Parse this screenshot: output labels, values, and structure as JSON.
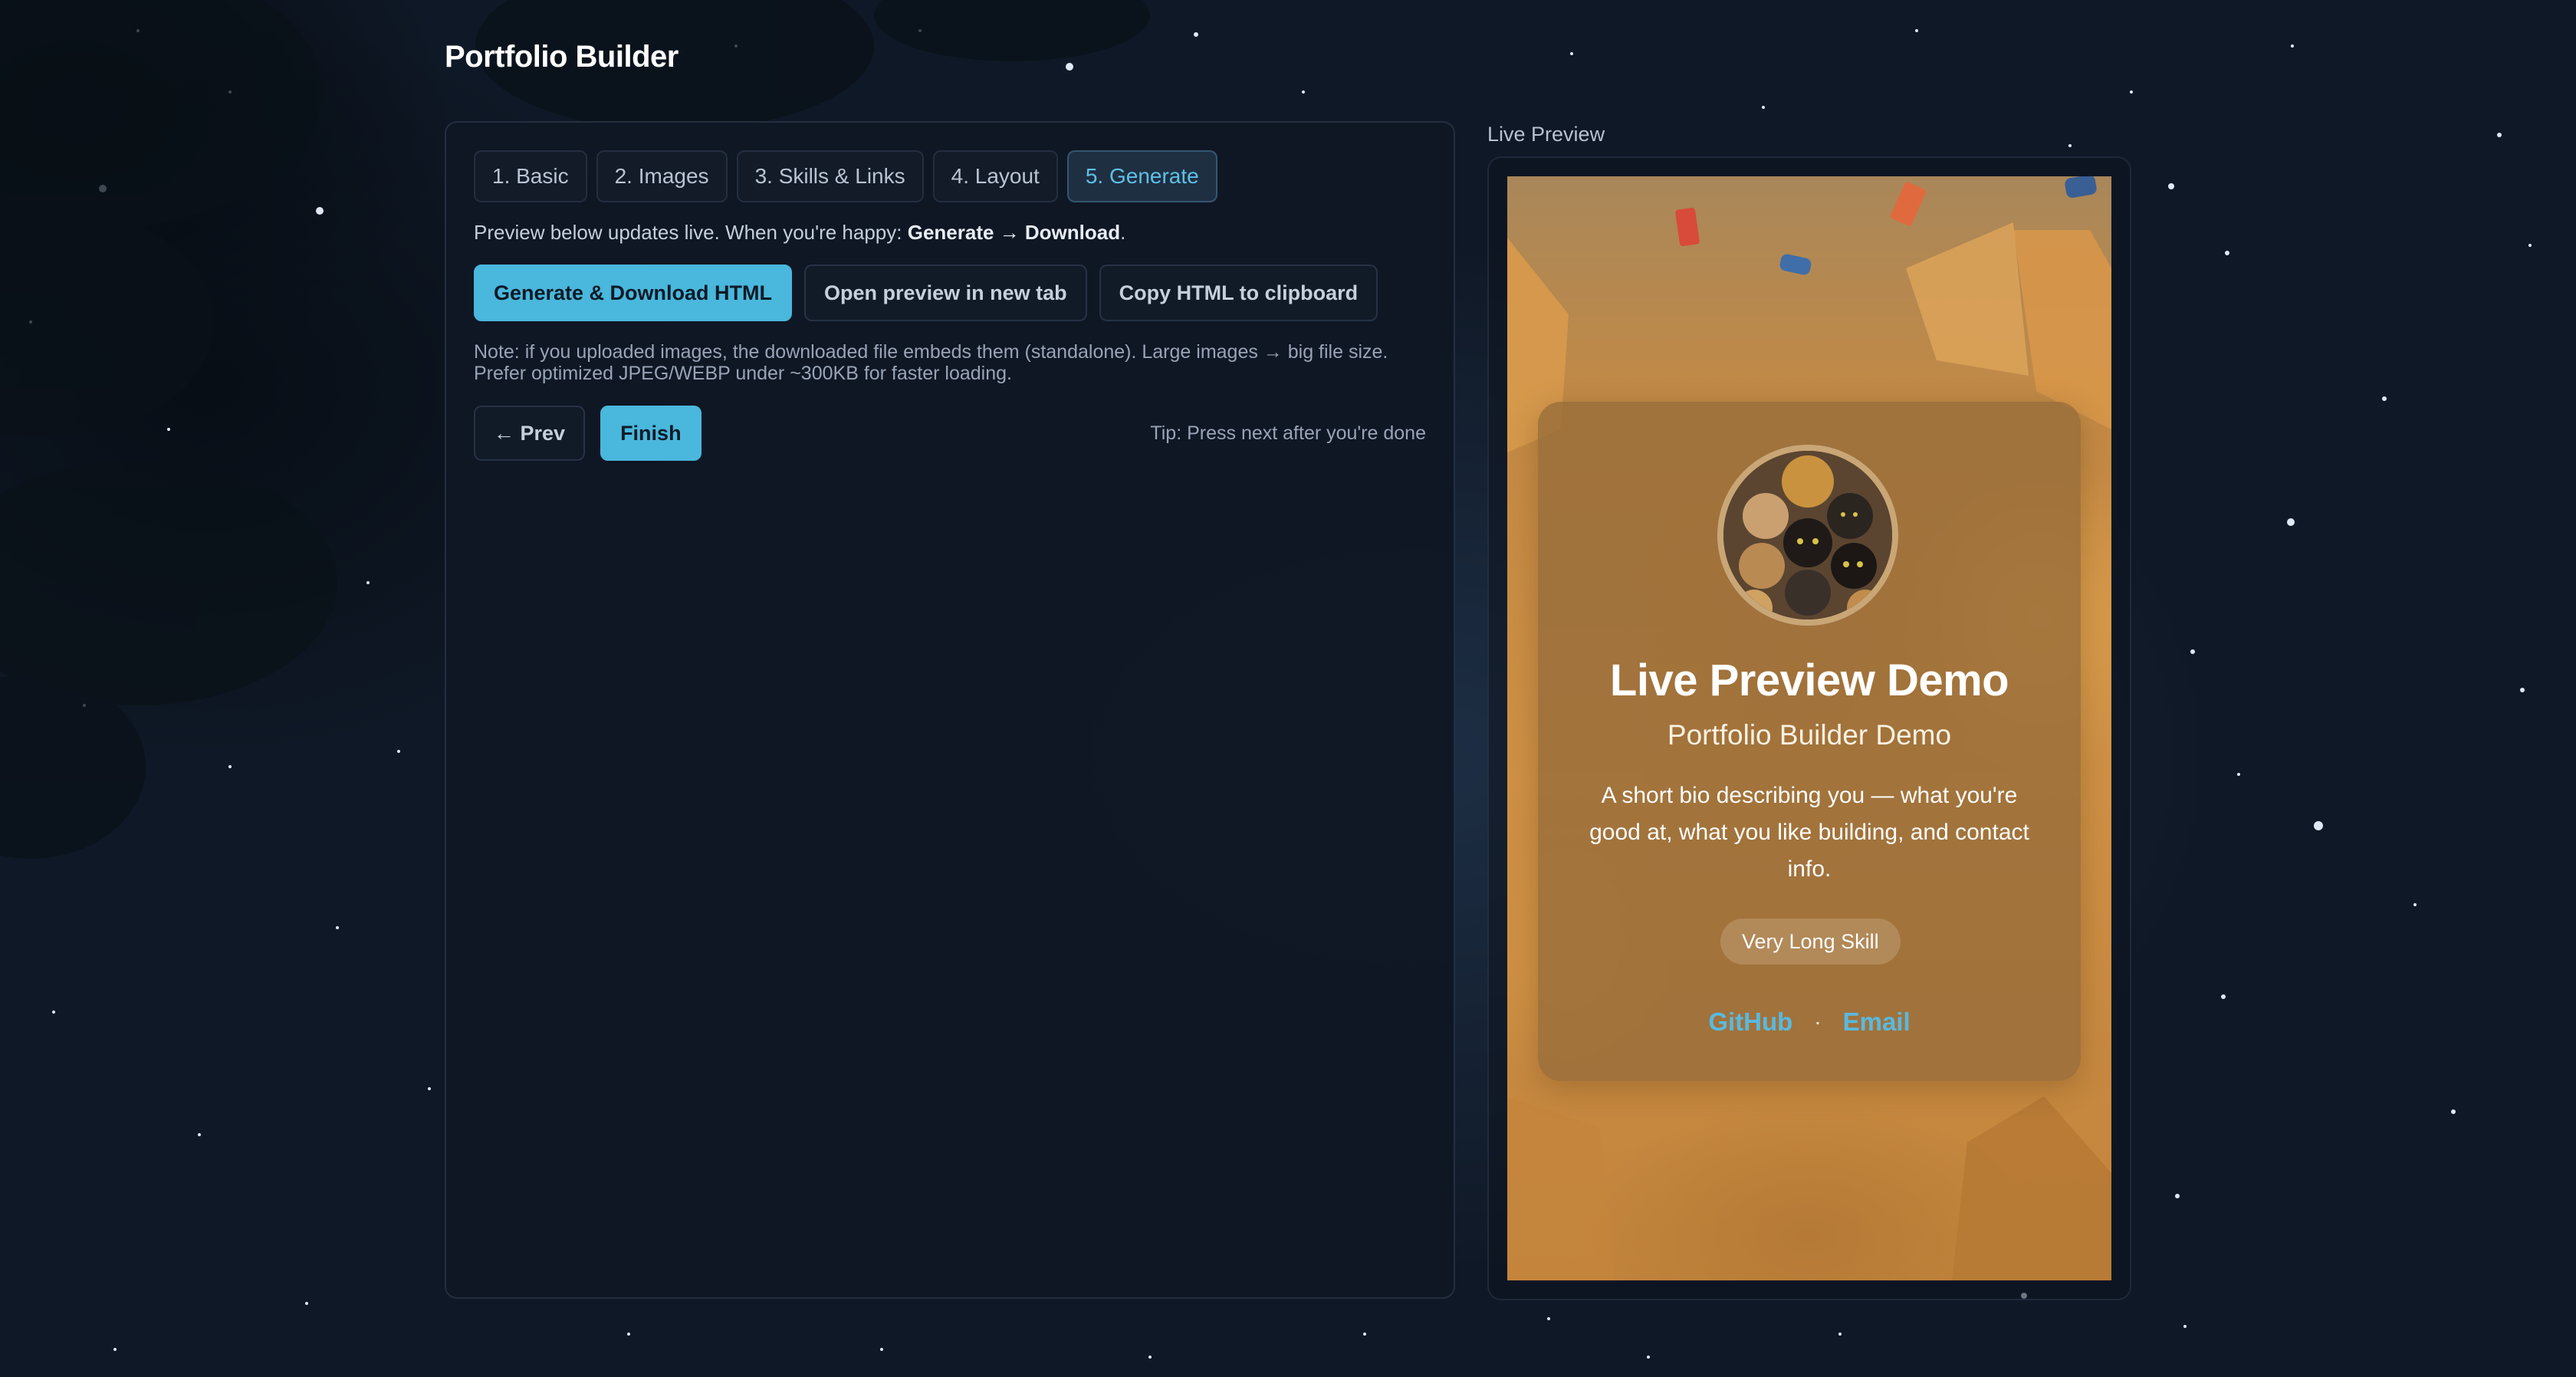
{
  "app": {
    "title": "Portfolio Builder"
  },
  "tabs": [
    {
      "label": "1. Basic",
      "active": false
    },
    {
      "label": "2. Images",
      "active": false
    },
    {
      "label": "3. Skills & Links",
      "active": false
    },
    {
      "label": "4. Layout",
      "active": false
    },
    {
      "label": "5. Generate",
      "active": true
    }
  ],
  "generate": {
    "intro_text": "Preview below updates live. When you're happy: ",
    "intro_strong": "Generate → Download",
    "intro_end": ".",
    "primary_button": "Generate & Download HTML",
    "open_preview_button": "Open preview in new tab",
    "copy_button": "Copy HTML to clipboard",
    "note_line1": "Note: if you uploaded images, the downloaded file embeds them (standalone). Large images → big file size.",
    "note_line2": "Prefer optimized JPEG/WEBP under ~300KB for faster loading."
  },
  "nav": {
    "prev_label": "← Prev",
    "finish_label": "Finish",
    "tip": "Tip: Press next after you're done"
  },
  "preview": {
    "label": "Live Preview",
    "card": {
      "name": "Live Preview Demo",
      "subtitle": "Portfolio Builder Demo",
      "bio": "A short bio describing you — what you're good at, what you like building, and contact info.",
      "skills": [
        "Very Long Skill"
      ],
      "links": [
        {
          "label": "GitHub"
        },
        {
          "label": "Email"
        }
      ],
      "link_separator": "·"
    }
  },
  "colors": {
    "accent": "#4ab7dc",
    "active_tab_text": "#5fc0e6",
    "link": "#59b9e0",
    "panel_bg": "#101724"
  }
}
